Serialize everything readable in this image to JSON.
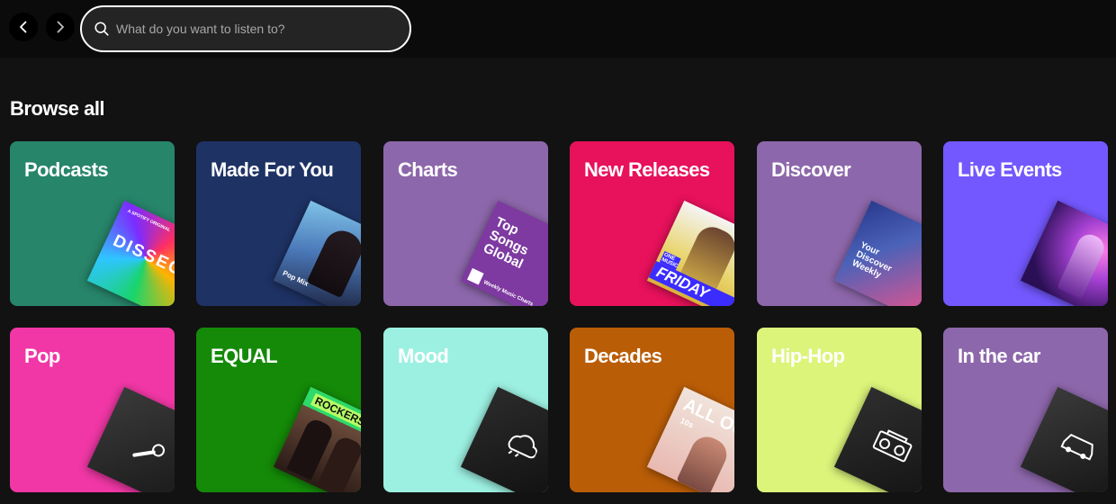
{
  "nav": {
    "back_icon": "chevron-left-icon",
    "forward_icon": "chevron-right-icon"
  },
  "search": {
    "placeholder": "What do you want to listen to?",
    "icon": "search-icon"
  },
  "browse": {
    "title": "Browse all",
    "categories": [
      {
        "label": "Podcasts",
        "color": "#27856a"
      },
      {
        "label": "Made For You",
        "color": "#1e3264"
      },
      {
        "label": "Charts",
        "color": "#8d67ab"
      },
      {
        "label": "New Releases",
        "color": "#e8115b"
      },
      {
        "label": "Discover",
        "color": "#8d67ab"
      },
      {
        "label": "Live Events",
        "color": "#7358ff"
      },
      {
        "label": "Pop",
        "color": "#f037a5"
      },
      {
        "label": "EQUAL",
        "color": "#148a08"
      },
      {
        "label": "Mood",
        "color": "#9cf0e1"
      },
      {
        "label": "Decades",
        "color": "#ba5d07"
      },
      {
        "label": "Hip-Hop",
        "color": "#dcf47a"
      },
      {
        "label": "In the car",
        "color": "#8d67ab"
      }
    ],
    "art": {
      "podcasts": {
        "header": "A SPOTIFY ORIGINAL",
        "title": "DISSECT"
      },
      "made_for_you": {
        "title": "Pop Mix"
      },
      "charts": {
        "title": "Top Songs Global",
        "caption": "Weekly Music Charts"
      },
      "new_releases": {
        "badge": "ONE MUSIC",
        "title": "FRIDAY"
      },
      "discover": {
        "title": "Your Discover Weekly"
      },
      "equal": {
        "title": "ROCKERS"
      },
      "decades": {
        "title": "ALL OUT",
        "sub": "10s"
      }
    }
  }
}
